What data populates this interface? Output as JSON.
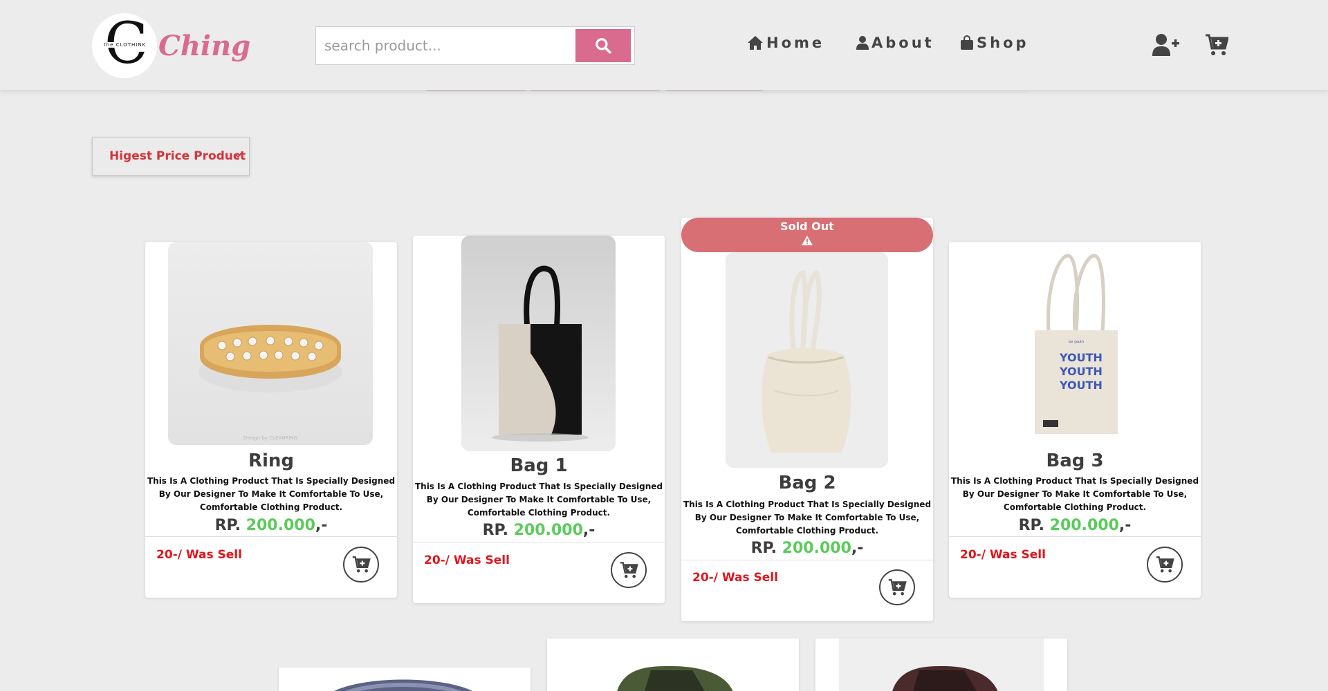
{
  "header": {
    "brand_small": "the CLOTHINK",
    "brand_name": "Ching",
    "search": {
      "placeholder": "search product...",
      "value": ""
    },
    "nav": [
      {
        "label": "Home",
        "icon": "home-icon"
      },
      {
        "label": "About",
        "icon": "user-icon"
      },
      {
        "label": "Shop",
        "icon": "shopping-bag-icon"
      }
    ],
    "actions": {
      "add_user_icon": "user-plus-icon",
      "cart_icon": "cart-plus-icon"
    }
  },
  "sort": {
    "selected": "Higest Price Product"
  },
  "products": [
    {
      "title": "Ring",
      "description": "This Is A Clothing Product That Is Specially Designed By Our Designer To Make It Comfortable To Use, Comfortable Clothing Product.",
      "price_prefix": "RP.",
      "price_value": "200.000",
      "price_suffix": ",-",
      "sold_text": "20-/ Was Sell",
      "image_watermark": "Design by CLEANRING"
    },
    {
      "title": "Bag 1",
      "description": "This Is A Clothing Product That Is Specially Designed By Our Designer To Make It Comfortable To Use, Comfortable Clothing Product.",
      "price_prefix": "RP.",
      "price_value": "200.000",
      "price_suffix": ",-",
      "sold_text": "20-/ Was Sell"
    },
    {
      "title": "Bag 2",
      "description": "This Is A Clothing Product That Is Specially Designed By Our Designer To Make It Comfortable To Use, Comfortable Clothing Product.",
      "price_prefix": "RP.",
      "price_value": "200.000",
      "price_suffix": ",-",
      "sold_text": "20-/ Was Sell",
      "badge": "Sold Out"
    },
    {
      "title": "Bag 3",
      "description": "This Is A Clothing Product That Is Specially Designed By Our Designer To Make It Comfortable To Use, Comfortable Clothing Product.",
      "price_prefix": "RP.",
      "price_value": "200.000",
      "price_suffix": ",-",
      "sold_text": "20-/ Was Sell",
      "image_text": "YOUTH YOUTH YOUTH"
    }
  ],
  "colors": {
    "accent": "#d96b8e",
    "price_green": "#5acb5a",
    "sold_red": "#e0151b",
    "soldout_badge": "#d86f74"
  }
}
